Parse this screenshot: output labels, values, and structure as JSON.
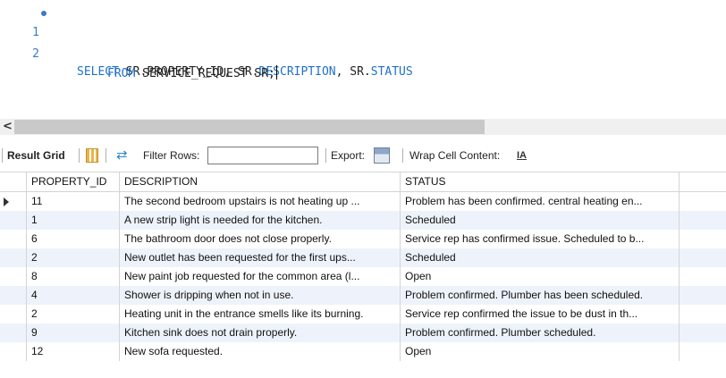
{
  "editor": {
    "lines": [
      {
        "number": "1",
        "executed": true,
        "tokens": [
          "SELECT",
          " SR.PROPERTY_ID, SR.",
          "DESCRIPTION",
          ", SR.",
          "STATUS"
        ]
      },
      {
        "number": "2",
        "tokens": [
          "FROM",
          " SERVICE_REQUEST SR;"
        ]
      }
    ]
  },
  "toolbar": {
    "result_grid_label": "Result Grid",
    "filter_label": "Filter Rows:",
    "filter_value": "",
    "export_label": "Export:",
    "wrap_label": "Wrap Cell Content:",
    "wrap_icon_text": "IA"
  },
  "grid": {
    "columns": [
      "PROPERTY_ID",
      "DESCRIPTION",
      "STATUS"
    ],
    "rows": [
      {
        "id": "11",
        "description": "The second bedroom upstairs is not heating up ...",
        "status": "Problem has been confirmed. central heating en..."
      },
      {
        "id": "1",
        "description": "A new strip light is needed for the kitchen.",
        "status": "Scheduled"
      },
      {
        "id": "6",
        "description": "The bathroom door does not close properly.",
        "status": "Service rep has confirmed issue. Scheduled to b..."
      },
      {
        "id": "2",
        "description": "New outlet has been requested for the first ups...",
        "status": "Scheduled"
      },
      {
        "id": "8",
        "description": "New paint job requested for the common area (l...",
        "status": "Open"
      },
      {
        "id": "4",
        "description": "Shower is dripping when not in use.",
        "status": "Problem confirmed. Plumber has been scheduled."
      },
      {
        "id": "2",
        "description": "Heating unit in the entrance smells like its burning.",
        "status": "Service rep confirmed the issue to be dust in th..."
      },
      {
        "id": "9",
        "description": "Kitchen sink does not drain properly.",
        "status": "Problem confirmed. Plumber scheduled."
      },
      {
        "id": "12",
        "description": "New sofa requested.",
        "status": "Open"
      }
    ]
  },
  "colors": {
    "keyword": "#1f70c8",
    "line_number": "#3b7ac4",
    "alt_row": "#eef3fb"
  }
}
